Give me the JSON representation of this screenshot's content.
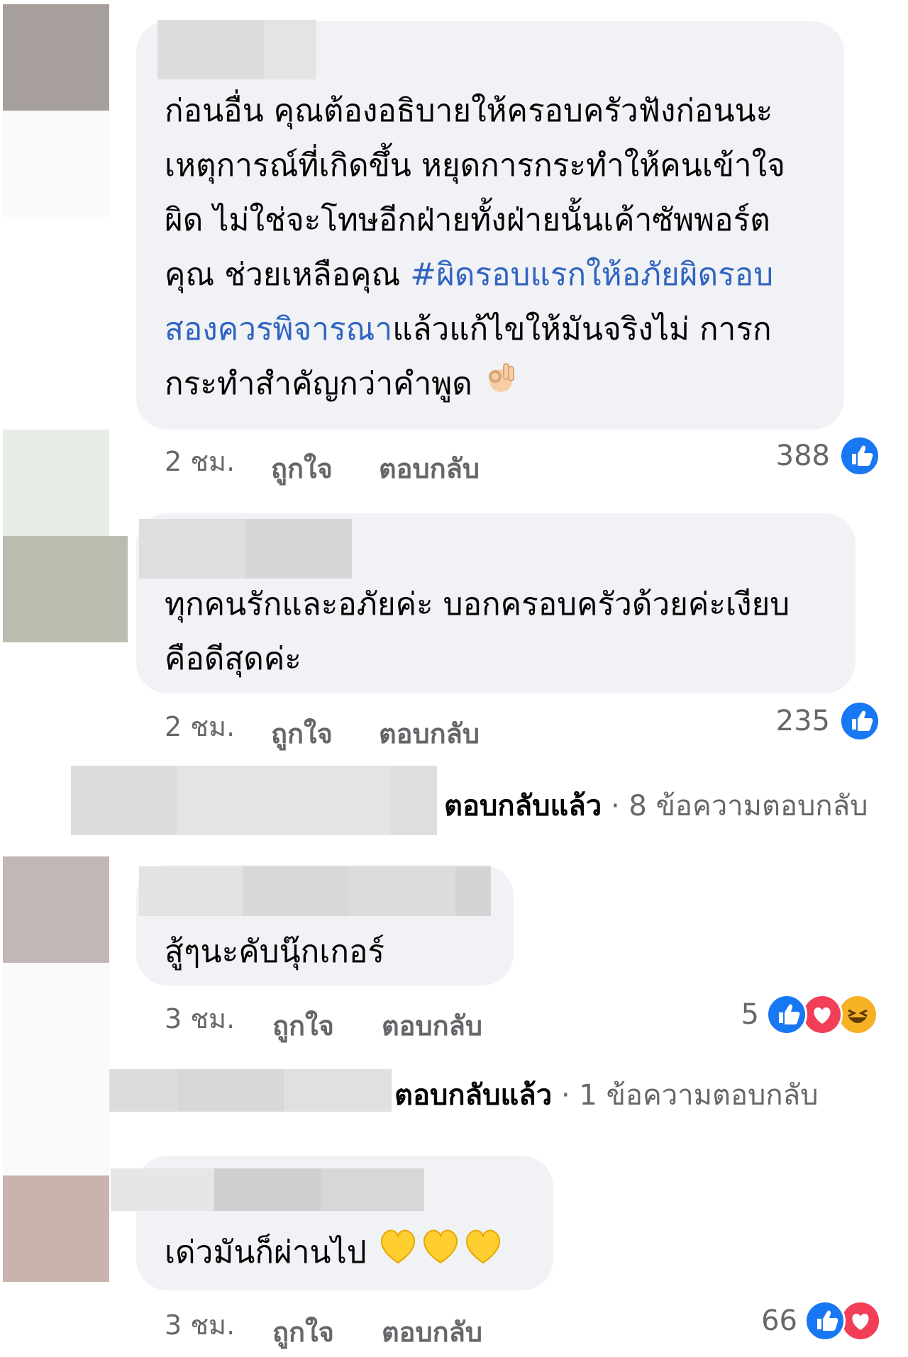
{
  "comments": [
    {
      "text_plain_1": "ก่อนอื่น คุณต้องอธิบายให้ครอบครัวฟังก่อนนะ\nเหตุการณ์ที่เกิดขึ้น หยุดการกระทำให้คนเข้าใจ\nผิด ไม่ใช่จะโทษอีกฝ่ายทั้งฝ่ายนั้นเค้าซัพพอร์ต\nคุณ ช่วยเหลือคุณ ",
      "hashtag": "#ผิดรอบแรกให้อภัยผิดรอบ\nสองควรพิจารณา",
      "text_plain_2": "แล้วแก้ไขให้มันจริงไม่ การก\nกระทำสำคัญกว่าคำพูด",
      "emoji": "ok-hand",
      "time": "2 ชม.",
      "like_label": "ถูกใจ",
      "reply_label": "ตอบกลับ",
      "reaction_count": "388",
      "reactions": [
        "like"
      ]
    },
    {
      "text": "ทุกคนรักและอภัยค่ะ บอกครอบครัวด้วยค่ะเงียบ\nคือดีสุดค่ะ",
      "time": "2 ชม.",
      "like_label": "ถูกใจ",
      "reply_label": "ตอบกลับ",
      "reaction_count": "235",
      "reactions": [
        "like"
      ]
    },
    {
      "text": "สู้ๆนะคับนุ๊กเกอร์",
      "time": "3 ชม.",
      "like_label": "ถูกใจ",
      "reply_label": "ตอบกลับ",
      "reaction_count": "5",
      "reactions": [
        "like",
        "love",
        "haha"
      ]
    },
    {
      "text": "เด่วมันก็ผ่านไป",
      "emojis": [
        "yellow-heart",
        "yellow-heart",
        "yellow-heart"
      ],
      "time": "3 ชม.",
      "like_label": "ถูกใจ",
      "reply_label": "ตอบกลับ",
      "reaction_count": "66",
      "reactions": [
        "like",
        "love"
      ]
    }
  ],
  "reply_summaries": [
    {
      "replied_label": "ตอบกลับแล้ว",
      "separator": "·",
      "count_label": "8 ข้อความตอบกลับ"
    },
    {
      "replied_label": "ตอบกลับแล้ว",
      "separator": "·",
      "count_label": "1 ข้อความตอบกลับ"
    }
  ],
  "colors": {
    "bubble": "#f0f2f5",
    "meta_text": "#65676b",
    "hashtag": "#3164c1",
    "like_blue": "#1877f2",
    "love_red": "#f33e58",
    "haha_yellow": "#f7b125"
  }
}
